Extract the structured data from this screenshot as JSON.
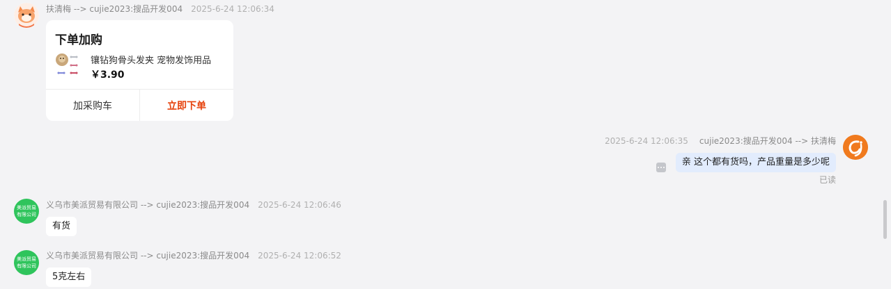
{
  "messages": [
    {
      "meta": {
        "from_to": "扶清梅 --> cujie2023:搜品开发004",
        "time": "2025-6-24 12:06:34"
      },
      "card": {
        "title": "下单加购",
        "product_name": "镶钻狗骨头发夹 宠物发饰用品",
        "price": "￥3.90",
        "add_cart_label": "加采购车",
        "order_now_label": "立即下单"
      }
    },
    {
      "meta": {
        "time": "2025-6-24 12:06:35",
        "from_to": "cujie2023:搜品开发004 --> 扶清梅"
      },
      "text": "亲 这个都有货吗，产品重量是多少呢",
      "status": "已读"
    },
    {
      "meta": {
        "from_to": "义乌市美派贸易有限公司 --> cujie2023:搜品开发004",
        "time": "2025-6-24 12:06:46"
      },
      "avatar_text": [
        "美派贸易",
        "有限公司"
      ],
      "text": "有货"
    },
    {
      "meta": {
        "from_to": "义乌市美派贸易有限公司 --> cujie2023:搜品开发004",
        "time": "2025-6-24 12:06:52"
      },
      "avatar_text": [
        "美派贸易",
        "有限公司"
      ],
      "text": "5克左右"
    }
  ],
  "colors": {
    "accent_order": "#e6410b",
    "bubble_sent": "#e2ecfd",
    "company_avatar": "#2fc45c",
    "cj_avatar": "#f07a1e"
  },
  "icons": {
    "avatar_cat": "cartoon-cat-avatar",
    "avatar_cj": "cj-logo-avatar",
    "more": "more-dots-icon"
  }
}
